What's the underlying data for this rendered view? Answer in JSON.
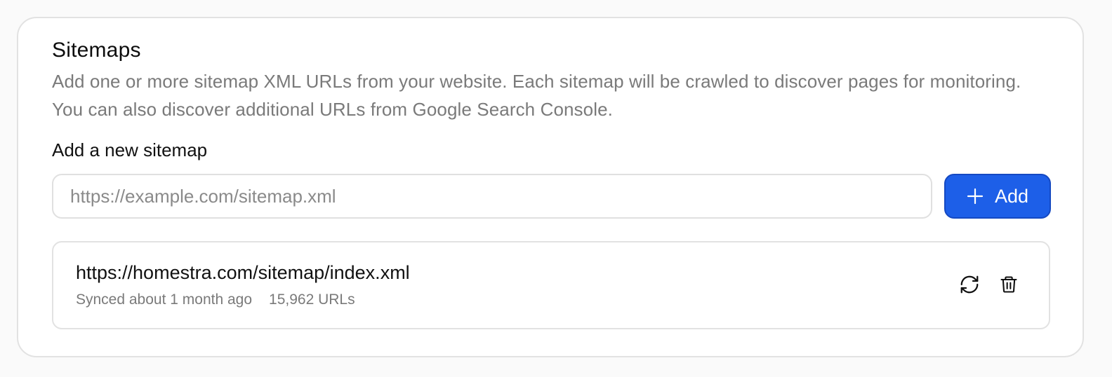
{
  "sitemaps": {
    "title": "Sitemaps",
    "description": "Add one or more sitemap XML URLs from your website. Each sitemap will be crawled to discover pages for monitoring. You can also discover additional URLs from Google Search Console.",
    "new_label": "Add a new sitemap",
    "input": {
      "placeholder": "https://example.com/sitemap.xml",
      "value": ""
    },
    "add_button": {
      "label": "Add",
      "icon": "plus-icon",
      "color": "#1d5fe8"
    },
    "items": [
      {
        "url": "https://homestra.com/sitemap/index.xml",
        "synced": "Synced about 1 month ago",
        "urls": "15,962 URLs",
        "actions": [
          "refresh-icon",
          "trash-icon"
        ]
      }
    ]
  }
}
